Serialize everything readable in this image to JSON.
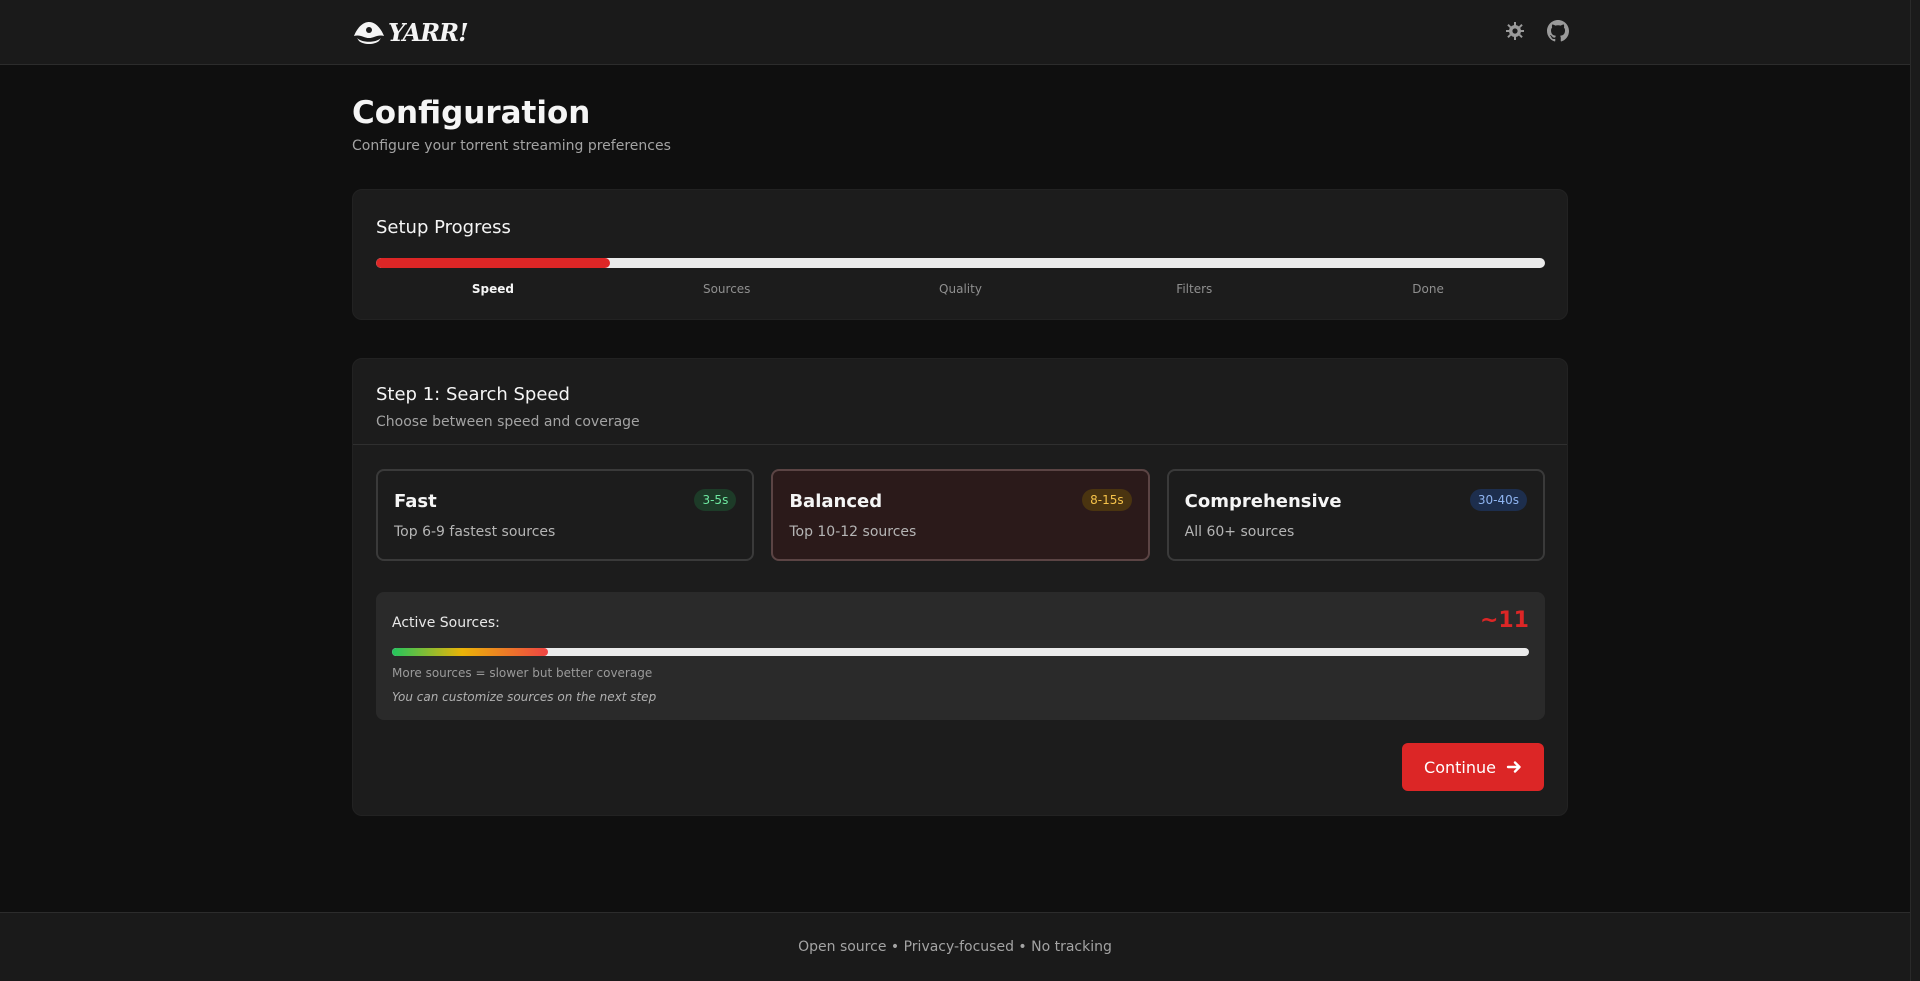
{
  "header": {
    "logo_text": "YARR!",
    "settings_icon": "gear-icon",
    "github_icon": "github-icon"
  },
  "page": {
    "title": "Configuration",
    "subtitle": "Configure your torrent streaming preferences"
  },
  "progress": {
    "title": "Setup Progress",
    "fraction": 0.2,
    "steps": [
      {
        "label": "Speed",
        "active": true
      },
      {
        "label": "Sources",
        "active": false
      },
      {
        "label": "Quality",
        "active": false
      },
      {
        "label": "Filters",
        "active": false
      },
      {
        "label": "Done",
        "active": false
      }
    ]
  },
  "step": {
    "title": "Step 1: Search Speed",
    "subtitle": "Choose between speed and coverage",
    "options": [
      {
        "name": "Fast",
        "desc": "Top 6-9 fastest sources",
        "badge": "3-5s",
        "selected": false
      },
      {
        "name": "Balanced",
        "desc": "Top 10-12 sources",
        "badge": "8-15s",
        "selected": true
      },
      {
        "name": "Comprehensive",
        "desc": "All 60+ sources",
        "badge": "30-40s",
        "selected": false
      }
    ],
    "active_sources": {
      "label": "Active Sources:",
      "count": "~11",
      "fraction": 0.137,
      "note": "More sources = slower but better coverage",
      "hint": "You can customize sources on the next step"
    },
    "continue_label": "Continue"
  },
  "footer": {
    "text": "Open source • Privacy-focused • No tracking"
  },
  "colors": {
    "accent": "#dc2626",
    "background": "#0f0f0f",
    "card": "#1c1c1c"
  }
}
